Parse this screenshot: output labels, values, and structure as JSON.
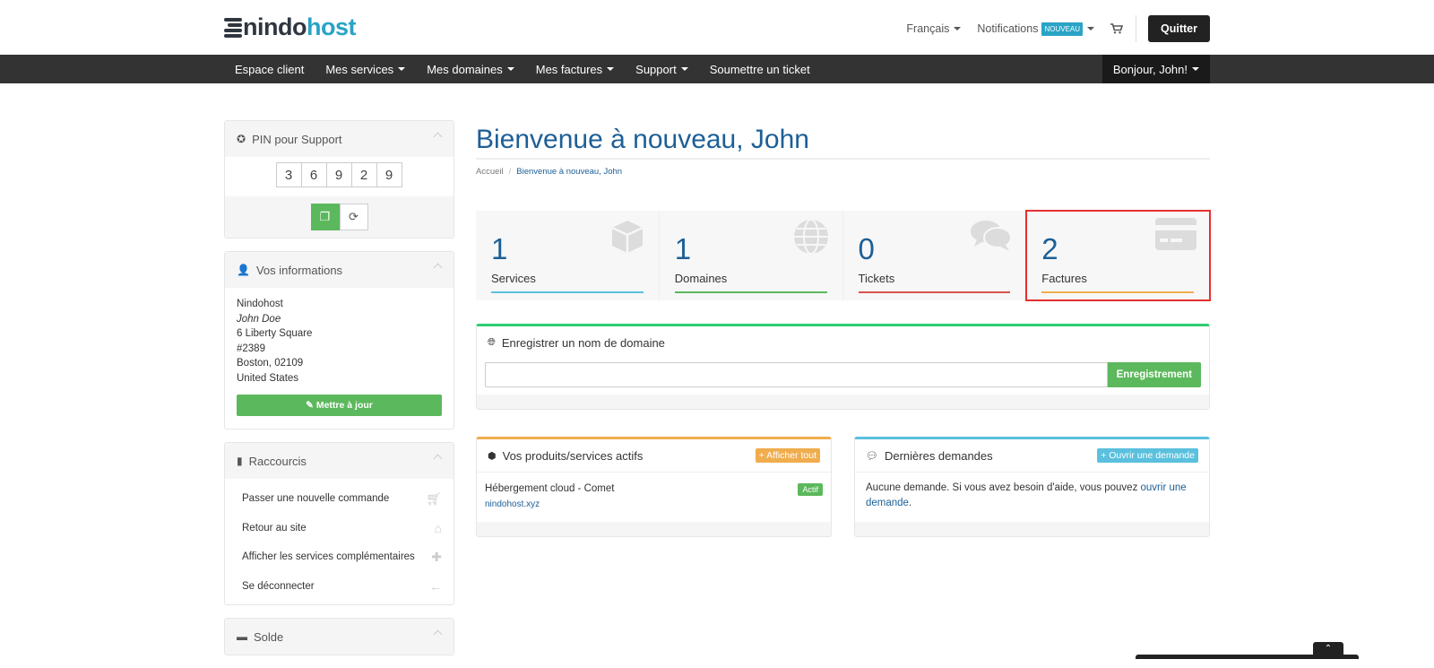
{
  "brand": {
    "part1": "nindo",
    "part2": "host"
  },
  "topbar": {
    "language": "Français",
    "notifications": "Notifications",
    "notifications_badge": "NOUVEAU",
    "quit": "Quitter",
    "cart_icon": "cart-icon"
  },
  "nav": {
    "items": [
      {
        "label": "Espace client",
        "dropdown": false
      },
      {
        "label": "Mes services",
        "dropdown": true
      },
      {
        "label": "Mes domaines",
        "dropdown": true
      },
      {
        "label": "Mes factures",
        "dropdown": true
      },
      {
        "label": "Support",
        "dropdown": true
      },
      {
        "label": "Soumettre un ticket",
        "dropdown": false
      }
    ],
    "user": "Bonjour, John!"
  },
  "sidebar": {
    "pin": {
      "title": "PIN pour Support",
      "digits": [
        "3",
        "6",
        "9",
        "2",
        "9"
      ]
    },
    "info": {
      "title": "Vos informations",
      "company": "Nindohost",
      "name": "John Doe",
      "address1": "6 Liberty Square",
      "address2": "#2389",
      "city": "Boston, 02109",
      "country": "United States",
      "update": "Mettre à jour"
    },
    "shortcuts": {
      "title": "Raccourcis",
      "items": [
        {
          "label": "Passer une nouvelle commande",
          "icon": "cart-icon"
        },
        {
          "label": "Retour au site",
          "icon": "home-icon"
        },
        {
          "label": "Afficher les services complémentaires",
          "icon": "puzzle-icon"
        },
        {
          "label": "Se déconnecter",
          "icon": "arrow-left-icon"
        }
      ]
    },
    "balance": {
      "title": "Solde"
    }
  },
  "main": {
    "title": "Bienvenue à nouveau, John",
    "breadcrumb": {
      "home": "Accueil",
      "current": "Bienvenue à nouveau, John"
    },
    "tiles": [
      {
        "value": "1",
        "label": "Services",
        "color": "#5bc0de",
        "icon": "cube-icon"
      },
      {
        "value": "1",
        "label": "Domaines",
        "color": "#5cb85c",
        "icon": "globe-icon"
      },
      {
        "value": "0",
        "label": "Tickets",
        "color": "#d9534f",
        "icon": "comments-icon"
      },
      {
        "value": "2",
        "label": "Factures",
        "color": "#f0ad4e",
        "icon": "credit-card-icon"
      }
    ],
    "domain": {
      "title": "Enregistrer un nom de domaine",
      "placeholder": "",
      "button": "Enregistrement"
    },
    "products": {
      "title": "Vos produits/services actifs",
      "button": "+ Afficher tout",
      "item": {
        "name": "Hébergement cloud - Comet",
        "domain": "nindohost.xyz",
        "status": "Actif"
      }
    },
    "requests": {
      "title": "Dernières demandes",
      "button": "+ Ouvrir une demande",
      "text": "Aucune demande. Si vous avez besoin d'aide, vous pouvez ",
      "link": "ouvrir une demande",
      "end": "."
    }
  },
  "colors": {
    "primary": "#1d5f96",
    "green": "#5cb85c",
    "orange": "#f0ad4e",
    "blue": "#5bc0de",
    "highlight": "#e53030"
  }
}
